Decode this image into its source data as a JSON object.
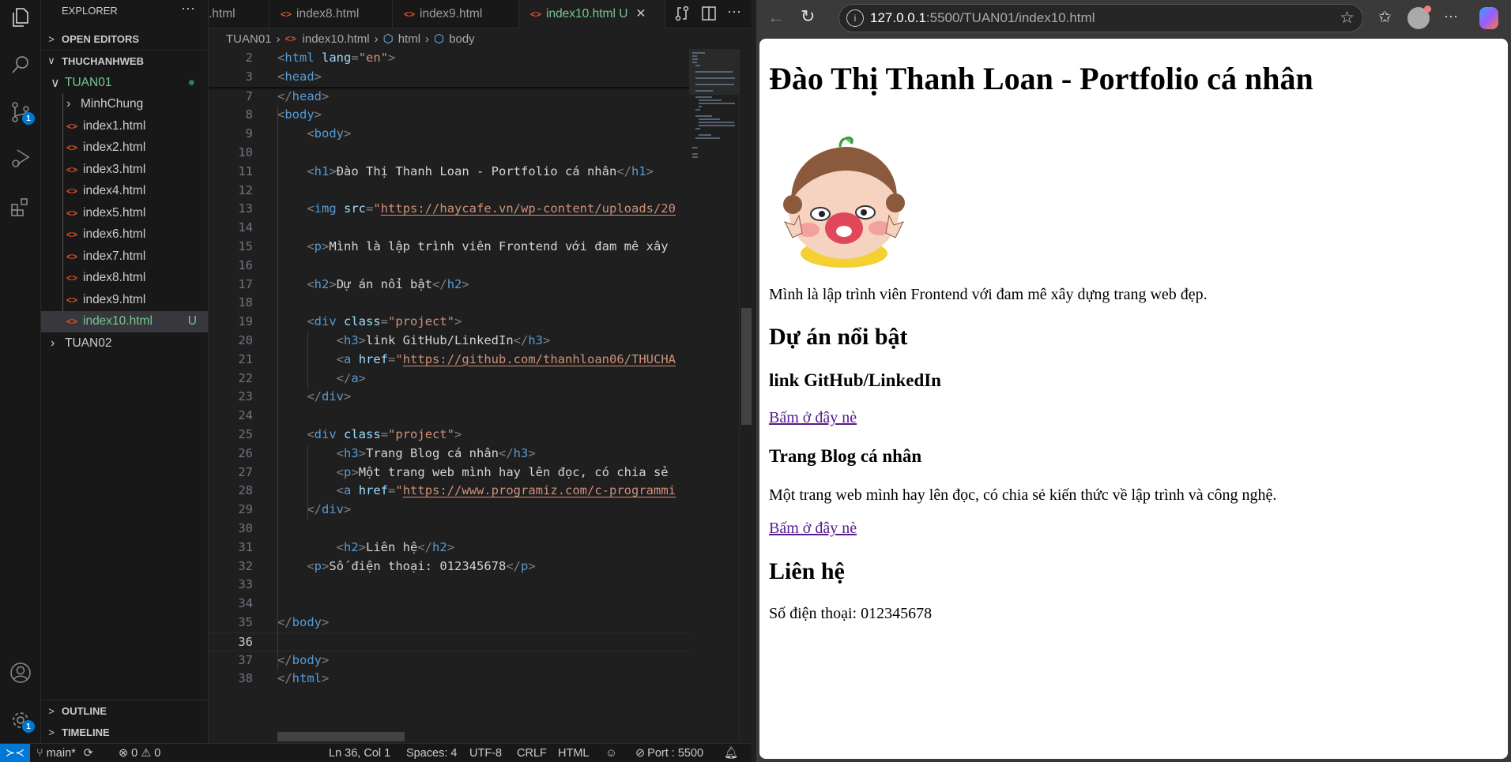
{
  "explorer": {
    "title": "EXPLORER",
    "more": "···",
    "sections": {
      "open_editors": "OPEN EDITORS",
      "workspace": "THUCHANHWEB",
      "outline": "OUTLINE",
      "timeline": "TIMELINE"
    },
    "tree": [
      {
        "label": "TUAN01",
        "kind": "folder-open",
        "status": "●"
      },
      {
        "label": "MinhChung",
        "kind": "folder"
      },
      {
        "label": "index1.html",
        "kind": "file"
      },
      {
        "label": "index2.html",
        "kind": "file"
      },
      {
        "label": "index3.html",
        "kind": "file"
      },
      {
        "label": "index4.html",
        "kind": "file"
      },
      {
        "label": "index5.html",
        "kind": "file"
      },
      {
        "label": "index6.html",
        "kind": "file"
      },
      {
        "label": "index7.html",
        "kind": "file"
      },
      {
        "label": "index8.html",
        "kind": "file"
      },
      {
        "label": "index9.html",
        "kind": "file"
      },
      {
        "label": "index10.html",
        "kind": "file",
        "status": "U",
        "selected": true
      },
      {
        "label": "TUAN02",
        "kind": "folder"
      }
    ]
  },
  "activity_bar": {
    "scm_badge": "1",
    "settings_badge": "1"
  },
  "tabs": [
    {
      "label": ".html"
    },
    {
      "label": "index8.html"
    },
    {
      "label": "index9.html"
    },
    {
      "label": "index10.html",
      "status": "U",
      "close": "✕",
      "active": true
    }
  ],
  "breadcrumb": {
    "folder": "TUAN01",
    "file": "index10.html",
    "sym1": "html",
    "sym2": "body"
  },
  "code": {
    "lines": [
      {
        "n": "2",
        "sticky": true,
        "tokens": [
          [
            "p",
            "<"
          ],
          [
            "t",
            "html"
          ],
          [
            "x",
            " "
          ],
          [
            "a",
            "lang"
          ],
          [
            "p",
            "="
          ],
          [
            "s",
            "\"en\""
          ],
          [
            "p",
            ">"
          ]
        ]
      },
      {
        "n": "3",
        "sticky": true,
        "tokens": [
          [
            "p",
            "<"
          ],
          [
            "t",
            "head"
          ],
          [
            "p",
            ">"
          ]
        ]
      },
      {
        "n": "7",
        "tokens": [
          [
            "p",
            "</"
          ],
          [
            "t",
            "head"
          ],
          [
            "p",
            ">"
          ]
        ]
      },
      {
        "n": "8",
        "tokens": [
          [
            "p",
            "<"
          ],
          [
            "t",
            "body"
          ],
          [
            "p",
            ">"
          ]
        ]
      },
      {
        "n": "9",
        "tokens": [
          [
            "x",
            "    "
          ],
          [
            "p",
            "<"
          ],
          [
            "t",
            "body"
          ],
          [
            "p",
            ">"
          ]
        ]
      },
      {
        "n": "10",
        "tokens": []
      },
      {
        "n": "11",
        "tokens": [
          [
            "x",
            "    "
          ],
          [
            "p",
            "<"
          ],
          [
            "t",
            "h1"
          ],
          [
            "p",
            ">"
          ],
          [
            "x",
            "Đào Thị Thanh Loan - Portfolio cá nhân"
          ],
          [
            "p",
            "</"
          ],
          [
            "t",
            "h1"
          ],
          [
            "p",
            ">"
          ]
        ]
      },
      {
        "n": "12",
        "tokens": []
      },
      {
        "n": "13",
        "tokens": [
          [
            "x",
            "    "
          ],
          [
            "p",
            "<"
          ],
          [
            "t",
            "img"
          ],
          [
            "x",
            " "
          ],
          [
            "a",
            "src"
          ],
          [
            "p",
            "="
          ],
          [
            "s",
            "\""
          ],
          [
            "u",
            "https://haycafe.vn/wp-content/uploads/20"
          ]
        ]
      },
      {
        "n": "14",
        "tokens": []
      },
      {
        "n": "15",
        "tokens": [
          [
            "x",
            "    "
          ],
          [
            "p",
            "<"
          ],
          [
            "t",
            "p"
          ],
          [
            "p",
            ">"
          ],
          [
            "x",
            "Mình là lập trình viên Frontend với đam mê xây"
          ]
        ]
      },
      {
        "n": "16",
        "tokens": []
      },
      {
        "n": "17",
        "tokens": [
          [
            "x",
            "    "
          ],
          [
            "p",
            "<"
          ],
          [
            "t",
            "h2"
          ],
          [
            "p",
            ">"
          ],
          [
            "x",
            "Dự án nổi bật"
          ],
          [
            "p",
            "</"
          ],
          [
            "t",
            "h2"
          ],
          [
            "p",
            ">"
          ]
        ]
      },
      {
        "n": "18",
        "tokens": []
      },
      {
        "n": "19",
        "tokens": [
          [
            "x",
            "    "
          ],
          [
            "p",
            "<"
          ],
          [
            "t",
            "div"
          ],
          [
            "x",
            " "
          ],
          [
            "a",
            "class"
          ],
          [
            "p",
            "="
          ],
          [
            "s",
            "\"project\""
          ],
          [
            "p",
            ">"
          ]
        ]
      },
      {
        "n": "20",
        "tokens": [
          [
            "x",
            "        "
          ],
          [
            "p",
            "<"
          ],
          [
            "t",
            "h3"
          ],
          [
            "p",
            ">"
          ],
          [
            "x",
            "link GitHub/LinkedIn"
          ],
          [
            "p",
            "</"
          ],
          [
            "t",
            "h3"
          ],
          [
            "p",
            ">"
          ]
        ]
      },
      {
        "n": "21",
        "tokens": [
          [
            "x",
            "        "
          ],
          [
            "p",
            "<"
          ],
          [
            "t",
            "a"
          ],
          [
            "x",
            " "
          ],
          [
            "a",
            "href"
          ],
          [
            "p",
            "="
          ],
          [
            "s",
            "\""
          ],
          [
            "u",
            "https://github.com/thanhloan06/THUCHA"
          ]
        ]
      },
      {
        "n": "22",
        "tokens": [
          [
            "x",
            "        "
          ],
          [
            "p",
            "</"
          ],
          [
            "t",
            "a"
          ],
          [
            "p",
            ">"
          ]
        ]
      },
      {
        "n": "23",
        "tokens": [
          [
            "x",
            "    "
          ],
          [
            "p",
            "</"
          ],
          [
            "t",
            "div"
          ],
          [
            "p",
            ">"
          ]
        ]
      },
      {
        "n": "24",
        "tokens": []
      },
      {
        "n": "25",
        "tokens": [
          [
            "x",
            "    "
          ],
          [
            "p",
            "<"
          ],
          [
            "t",
            "div"
          ],
          [
            "x",
            " "
          ],
          [
            "a",
            "class"
          ],
          [
            "p",
            "="
          ],
          [
            "s",
            "\"project\""
          ],
          [
            "p",
            ">"
          ]
        ]
      },
      {
        "n": "26",
        "tokens": [
          [
            "x",
            "        "
          ],
          [
            "p",
            "<"
          ],
          [
            "t",
            "h3"
          ],
          [
            "p",
            ">"
          ],
          [
            "x",
            "Trang Blog cá nhân"
          ],
          [
            "p",
            "</"
          ],
          [
            "t",
            "h3"
          ],
          [
            "p",
            ">"
          ]
        ]
      },
      {
        "n": "27",
        "tokens": [
          [
            "x",
            "        "
          ],
          [
            "p",
            "<"
          ],
          [
            "t",
            "p"
          ],
          [
            "p",
            ">"
          ],
          [
            "x",
            "Một trang web mình hay lên đọc, có chia sẻ"
          ]
        ]
      },
      {
        "n": "28",
        "tokens": [
          [
            "x",
            "        "
          ],
          [
            "p",
            "<"
          ],
          [
            "t",
            "a"
          ],
          [
            "x",
            " "
          ],
          [
            "a",
            "href"
          ],
          [
            "p",
            "="
          ],
          [
            "s",
            "\""
          ],
          [
            "u",
            "https://www.programiz.com/c-programmi"
          ]
        ]
      },
      {
        "n": "29",
        "tokens": [
          [
            "x",
            "    "
          ],
          [
            "p",
            "</"
          ],
          [
            "t",
            "div"
          ],
          [
            "p",
            ">"
          ]
        ]
      },
      {
        "n": "30",
        "tokens": []
      },
      {
        "n": "31",
        "tokens": [
          [
            "x",
            "        "
          ],
          [
            "p",
            "<"
          ],
          [
            "t",
            "h2"
          ],
          [
            "p",
            ">"
          ],
          [
            "x",
            "Liên hệ"
          ],
          [
            "p",
            "</"
          ],
          [
            "t",
            "h2"
          ],
          [
            "p",
            ">"
          ]
        ]
      },
      {
        "n": "32",
        "tokens": [
          [
            "x",
            "    "
          ],
          [
            "p",
            "<"
          ],
          [
            "t",
            "p"
          ],
          [
            "p",
            ">"
          ],
          [
            "x",
            "Số điện thoại: 012345678"
          ],
          [
            "p",
            "</"
          ],
          [
            "t",
            "p"
          ],
          [
            "p",
            ">"
          ]
        ]
      },
      {
        "n": "33",
        "tokens": []
      },
      {
        "n": "34",
        "tokens": []
      },
      {
        "n": "35",
        "tokens": [
          [
            "p",
            "</"
          ],
          [
            "t",
            "body"
          ],
          [
            "p",
            ">"
          ]
        ]
      },
      {
        "n": "36",
        "current": true,
        "tokens": []
      },
      {
        "n": "37",
        "tokens": [
          [
            "p",
            "</"
          ],
          [
            "t",
            "body"
          ],
          [
            "p",
            ">"
          ]
        ]
      },
      {
        "n": "38",
        "tokens": [
          [
            "p",
            "</"
          ],
          [
            "t",
            "html"
          ],
          [
            "p",
            ">"
          ]
        ]
      }
    ]
  },
  "statusbar": {
    "branch": "main*",
    "errors": "0",
    "warnings": "0",
    "position": "Ln 36, Col 1",
    "spaces": "Spaces: 4",
    "encoding": "UTF-8",
    "eol": "CRLF",
    "language": "HTML",
    "port": "Port : 5500"
  },
  "browser": {
    "url_host": "127.0.0.1",
    "url_rest": ":5500/TUAN01/index10.html",
    "more": "···"
  },
  "page": {
    "h1": "Đào Thị Thanh Loan - Portfolio cá nhân",
    "intro": "Mình là lập trình viên Frontend với đam mê xây dựng trang web đẹp.",
    "projects_heading": "Dự án nổi bật",
    "project1_title": "link GitHub/LinkedIn",
    "project1_link": "Bấm ở đây nè",
    "project2_title": "Trang Blog cá nhân",
    "project2_desc": "Một trang web mình hay lên đọc, có chia sẻ kiến thức về lập trình và công nghệ.",
    "project2_link": "Bấm ở đây nè",
    "contact_heading": "Liên hệ",
    "phone": "Số điện thoại: 012345678"
  },
  "colors": {
    "accent": "#0078d4",
    "git_untracked": "#73c991",
    "html_icon": "#e44d26",
    "link_visited": "#551a8b"
  }
}
